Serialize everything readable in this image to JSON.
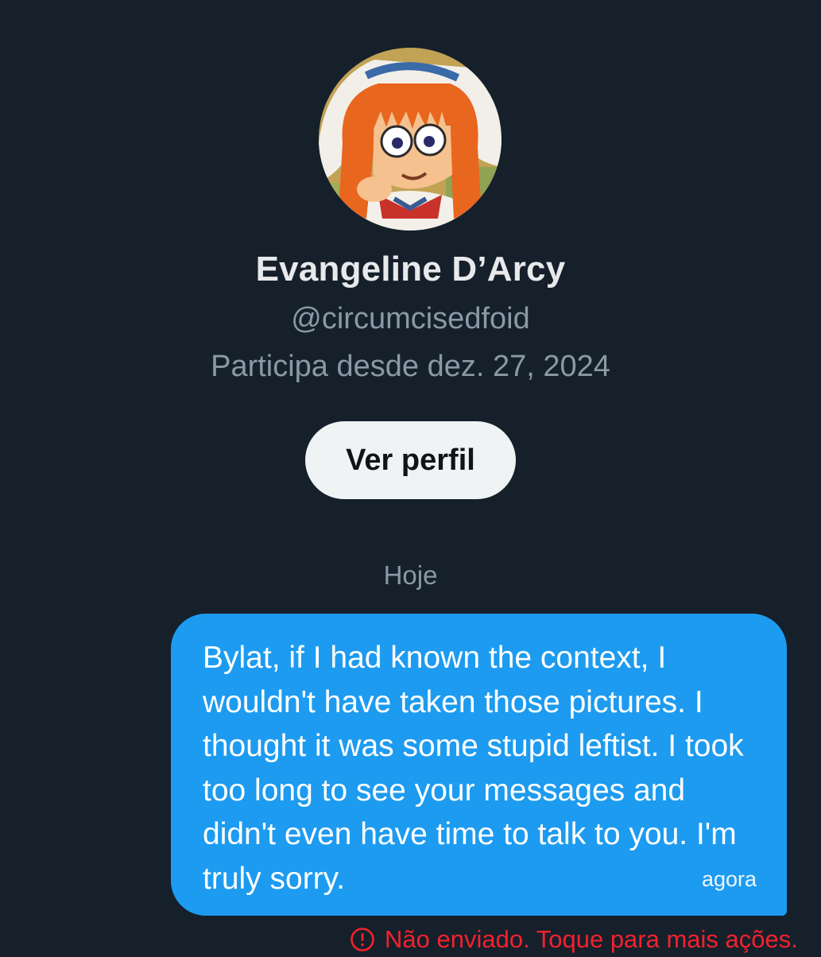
{
  "profile": {
    "display_name": "Evangeline D’Arcy",
    "handle": "@circumcisedfoid",
    "joined": "Participa desde dez. 27, 2024",
    "view_profile_label": "Ver perfil"
  },
  "conversation": {
    "day_label": "Hoje",
    "messages": [
      {
        "text": "Bylat, if I had known the context, I wouldn't have taken those pictures. I thought it was some stupid leftist. I took too long to see your messages and didn't even have time to talk to you. I'm truly sorry.",
        "time": "agora",
        "status": "Não enviado. Toque para mais ações."
      }
    ]
  },
  "colors": {
    "background": "#15202b",
    "bubble": "#1d9bf0",
    "error": "#f4212e",
    "muted_text": "#8b98a5",
    "button_bg": "#eff3f4"
  },
  "icons": {
    "status": "alert-circle-icon"
  }
}
